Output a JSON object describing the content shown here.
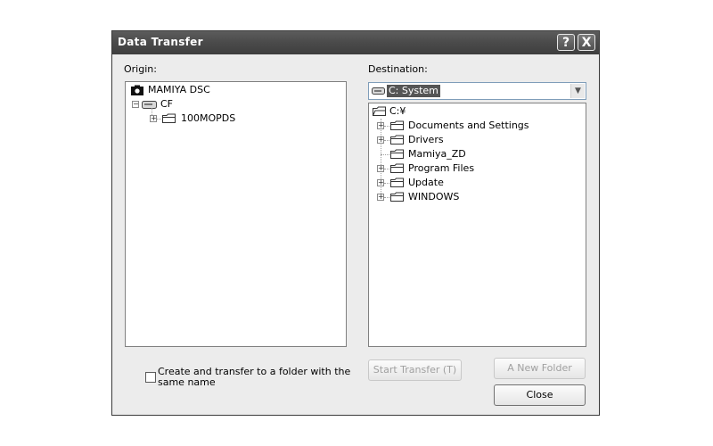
{
  "window": {
    "title": "Data Transfer",
    "help_label": "?",
    "close_label": "X"
  },
  "origin": {
    "label": "Origin:",
    "tree": {
      "root": "MAMIYA DSC",
      "drive": "CF",
      "folder": "100MOPDS"
    }
  },
  "destination": {
    "label": "Destination:",
    "drive_select": {
      "value": "C: System"
    },
    "tree": {
      "root": "C:¥",
      "items": [
        "Documents and Settings",
        "Drivers",
        "Mamiya_ZD",
        "Program Files",
        "Update",
        "WINDOWS"
      ]
    }
  },
  "options": {
    "create_folder_label": "Create and transfer to a folder with the same name"
  },
  "buttons": {
    "start_transfer": "Start Transfer (T)",
    "new_folder": "A New Folder",
    "close": "Close"
  }
}
